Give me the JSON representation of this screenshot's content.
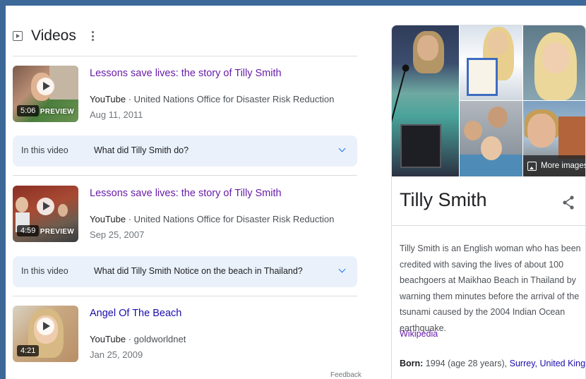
{
  "videos": {
    "title": "Videos",
    "items": [
      {
        "title": "Lessons save lives: the story of Tilly Smith",
        "source": "YouTube",
        "channel": " · United Nations Office for Disaster Risk Reduction",
        "date": "Aug 11, 2011",
        "duration": "5:06",
        "preview": "PREVIEW",
        "in_this_video": {
          "label": "In this video",
          "question": "What did Tilly Smith do?"
        }
      },
      {
        "title": "Lessons save lives: the story of Tilly Smith",
        "source": "YouTube",
        "channel": " · United Nations Office for Disaster Risk Reduction",
        "date": "Sep 25, 2007",
        "duration": "4:59",
        "preview": "PREVIEW",
        "in_this_video": {
          "label": "In this video",
          "question": "What did Tilly Smith Notice on the beach in Thailand?"
        }
      },
      {
        "title": "Angel Of The Beach",
        "source": "YouTube",
        "channel": " · goldworldnet",
        "date": "Jan 25, 2009",
        "duration": "4:21"
      }
    ],
    "feedback": "Feedback"
  },
  "knowledge_panel": {
    "more_images": "More images",
    "title": "Tilly Smith",
    "description": "Tilly Smith is an English woman who has been credited with saving the lives of about 100 beachgoers at Maikhao Beach in Thailand by warning them minutes before the arrival of the tsunami caused by the 2004 Indian Ocean earthquake.",
    "source": "Wikipedia",
    "born_label": "Born:",
    "born_value": " 1994 (age 28 years), ",
    "born_place": "Surrey, United Kingdom"
  },
  "icons": [
    "play-box-icon",
    "kebab-menu-icon",
    "play-icon",
    "chevron-down-icon",
    "image-icon",
    "share-icon"
  ],
  "colors": {
    "frame": "#3d6999",
    "visited_link": "#681da8",
    "link": "#1a0dab",
    "accent_blue": "#1a73e8",
    "chip_bg": "#eaf1fb"
  }
}
